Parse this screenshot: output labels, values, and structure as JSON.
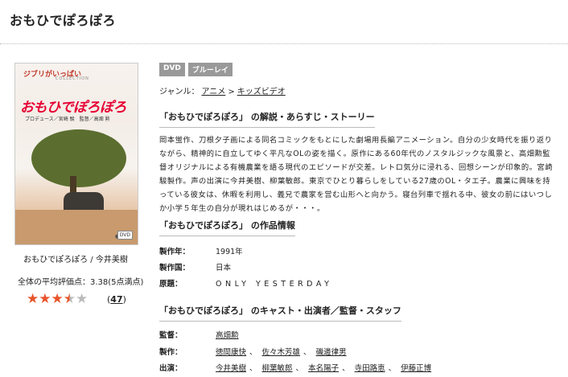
{
  "page": {
    "title": "おもひでぽろぽろ"
  },
  "cover": {
    "logo_text": "ジブリがいっぱい",
    "logo_sub": "COLLECTION",
    "cover_title": "おもひでぽろぽろ",
    "credits": "プロデュース／宮崎 駿　監督／高畑 勲",
    "format_mark": "DVD"
  },
  "caption": "おもひでぽろぽろ / 今井美樹",
  "rating": {
    "label": "全体の平均評価点：3.38(5点満点)",
    "score": 3.38,
    "max": 5,
    "stars": [
      "on",
      "on",
      "on",
      "half",
      "off"
    ],
    "review_count": "47",
    "paren_open": "(",
    "paren_close": ")",
    "accent_color": "#e8542c"
  },
  "badges": [
    "DVD",
    "ブルーレイ"
  ],
  "genre": {
    "label": "ジャンル：",
    "items": [
      "アニメ",
      "キッズビデオ"
    ],
    "separator": ">"
  },
  "synopsis": {
    "heading": "「おもひでぽろぽろ」 の解説・あらすじ・ストーリー",
    "text": "岡本蛍作、刀根夕子画による同名コミックをもとにした劇場用長編アニメーション。自分の少女時代を振り返りながら、精神的に自立してゆく平凡なOLの姿を描く。原作にある60年代のノスタルジックな風景と、高畑勲監督オリジナルによる有機農業を語る現代のエピソードが交差。レトロ気分に浸れる、回想シーンが印象的。宮崎駿製作。声の出演に今井美樹、柳葉敏郎。東京でひとり暮らしをしている27歳のOL・タエ子。農業に興味を持っている彼女は、休暇を利用し、義兄で農家を営む山形へと向かう。寝台列車で揺れる中、彼女の前にはいつしか小学５年生の自分が現れはじめるが・・・。"
  },
  "info": {
    "heading": "「おもひでぽろぽろ」 の作品情報",
    "rows": [
      {
        "label": "製作年：",
        "value": "1991年"
      },
      {
        "label": "製作国：",
        "value": "日本"
      },
      {
        "label": "原題：",
        "value": "ONLY YESTERDAY"
      }
    ]
  },
  "cast": {
    "heading": "「おもひでぽろぽろ」 のキャスト・出演者／監督・スタッフ",
    "director_label": "監督：",
    "directors": [
      "高畑勲"
    ],
    "producer_label": "製作：",
    "producers": [
      "徳間康快",
      "佐々木芳雄",
      "磯邊律男"
    ],
    "cast_label": "出演：",
    "performers": [
      "今井美樹",
      "柳葉敏郎",
      "本名陽子",
      "寺田路恵",
      "伊藤正博"
    ],
    "separator": "、"
  }
}
